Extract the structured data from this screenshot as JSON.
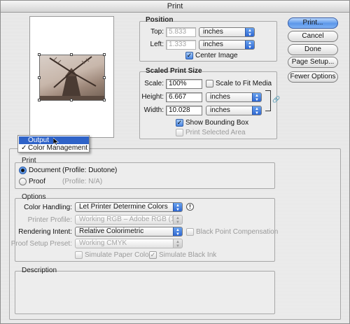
{
  "window": {
    "title": "Print"
  },
  "buttons": {
    "print": "Print...",
    "cancel": "Cancel",
    "done": "Done",
    "page_setup": "Page Setup...",
    "fewer_options": "Fewer Options"
  },
  "position": {
    "title": "Position",
    "top_label": "Top:",
    "top_value": "5.833",
    "top_unit": "inches",
    "left_label": "Left:",
    "left_value": "1.333",
    "left_unit": "inches",
    "center_image_label": "Center Image",
    "center_image_checked": true
  },
  "scaled": {
    "title": "Scaled Print Size",
    "scale_label": "Scale:",
    "scale_value": "100%",
    "scale_to_fit_label": "Scale to Fit Media",
    "scale_to_fit_checked": false,
    "height_label": "Height:",
    "height_value": "6.667",
    "height_unit": "inches",
    "width_label": "Width:",
    "width_value": "10.028",
    "width_unit": "inches",
    "show_bounding_label": "Show Bounding Box",
    "show_bounding_checked": true,
    "print_selected_label": "Print Selected Area",
    "print_selected_checked": false
  },
  "menu": {
    "items": [
      {
        "label": "Output",
        "selected": true
      },
      {
        "label": "Color Management",
        "checked": true
      }
    ]
  },
  "print_group": {
    "title": "Print",
    "document_label": "Document",
    "document_profile": "(Profile: Duotone)",
    "proof_label": "Proof",
    "proof_profile": "(Profile: N/A)",
    "selected": "Document"
  },
  "options": {
    "title": "Options",
    "color_handling_label": "Color Handling:",
    "color_handling_value": "Let Printer Determine Colors",
    "printer_profile_label": "Printer Profile:",
    "printer_profile_value": "Working RGB – Adobe RGB (19...",
    "rendering_intent_label": "Rendering Intent:",
    "rendering_intent_value": "Relative Colorimetric",
    "black_point_label": "Black Point Compensation",
    "proof_setup_label": "Proof Setup Preset:",
    "proof_setup_value": "Working CMYK",
    "simulate_paper_label": "Simulate Paper Color",
    "simulate_black_label": "Simulate Black Ink",
    "simulate_black_checked": true
  },
  "description": {
    "title": "Description"
  }
}
